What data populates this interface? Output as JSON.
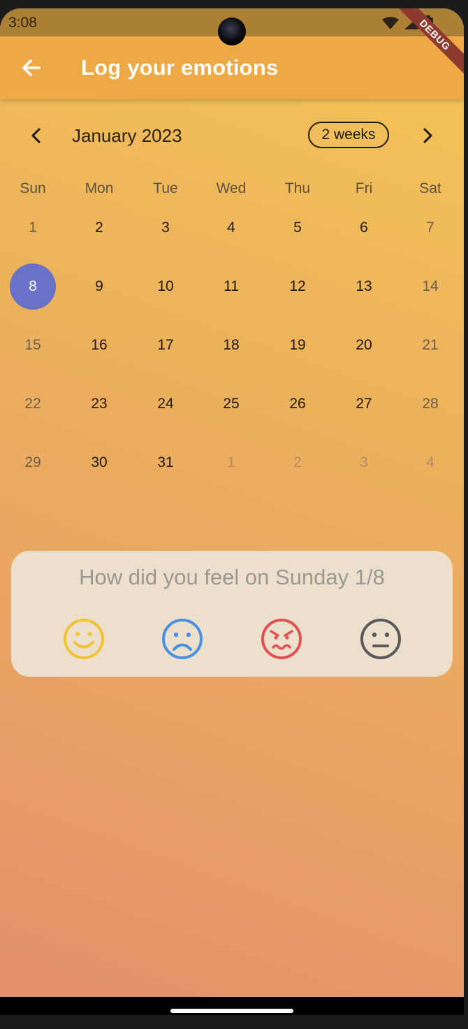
{
  "status_bar": {
    "time": "3:08",
    "debug_label": "DEBUG"
  },
  "app_bar": {
    "title": "Log your emotions",
    "back_icon": "arrow-back-icon"
  },
  "calendar": {
    "month_title": "January 2023",
    "format_button": "2 weeks",
    "prev_icon": "chevron-left-icon",
    "next_icon": "chevron-right-icon",
    "days_of_week": [
      "Sun",
      "Mon",
      "Tue",
      "Wed",
      "Thu",
      "Fri",
      "Sat"
    ],
    "weeks": [
      [
        "1",
        "2",
        "3",
        "4",
        "5",
        "6",
        "7"
      ],
      [
        "8",
        "9",
        "10",
        "11",
        "12",
        "13",
        "14"
      ],
      [
        "15",
        "16",
        "17",
        "18",
        "19",
        "20",
        "21"
      ],
      [
        "22",
        "23",
        "24",
        "25",
        "26",
        "27",
        "28"
      ],
      [
        "29",
        "30",
        "31",
        "1",
        "2",
        "3",
        "4"
      ]
    ],
    "selected_day": "8",
    "selected_color": "#6872c7"
  },
  "emotion_panel": {
    "question": "How did you feel on Sunday 1/8",
    "options": [
      {
        "icon": "happy-face-icon",
        "color": "#f1c232"
      },
      {
        "icon": "sad-face-icon",
        "color": "#4a90e2"
      },
      {
        "icon": "angry-face-icon",
        "color": "#e05151"
      },
      {
        "icon": "neutral-face-icon",
        "color": "#5a5a5a"
      }
    ]
  },
  "colors": {
    "app_bar": "#eca945",
    "background_top": "#f4c758",
    "background_bottom": "#e3906d"
  }
}
